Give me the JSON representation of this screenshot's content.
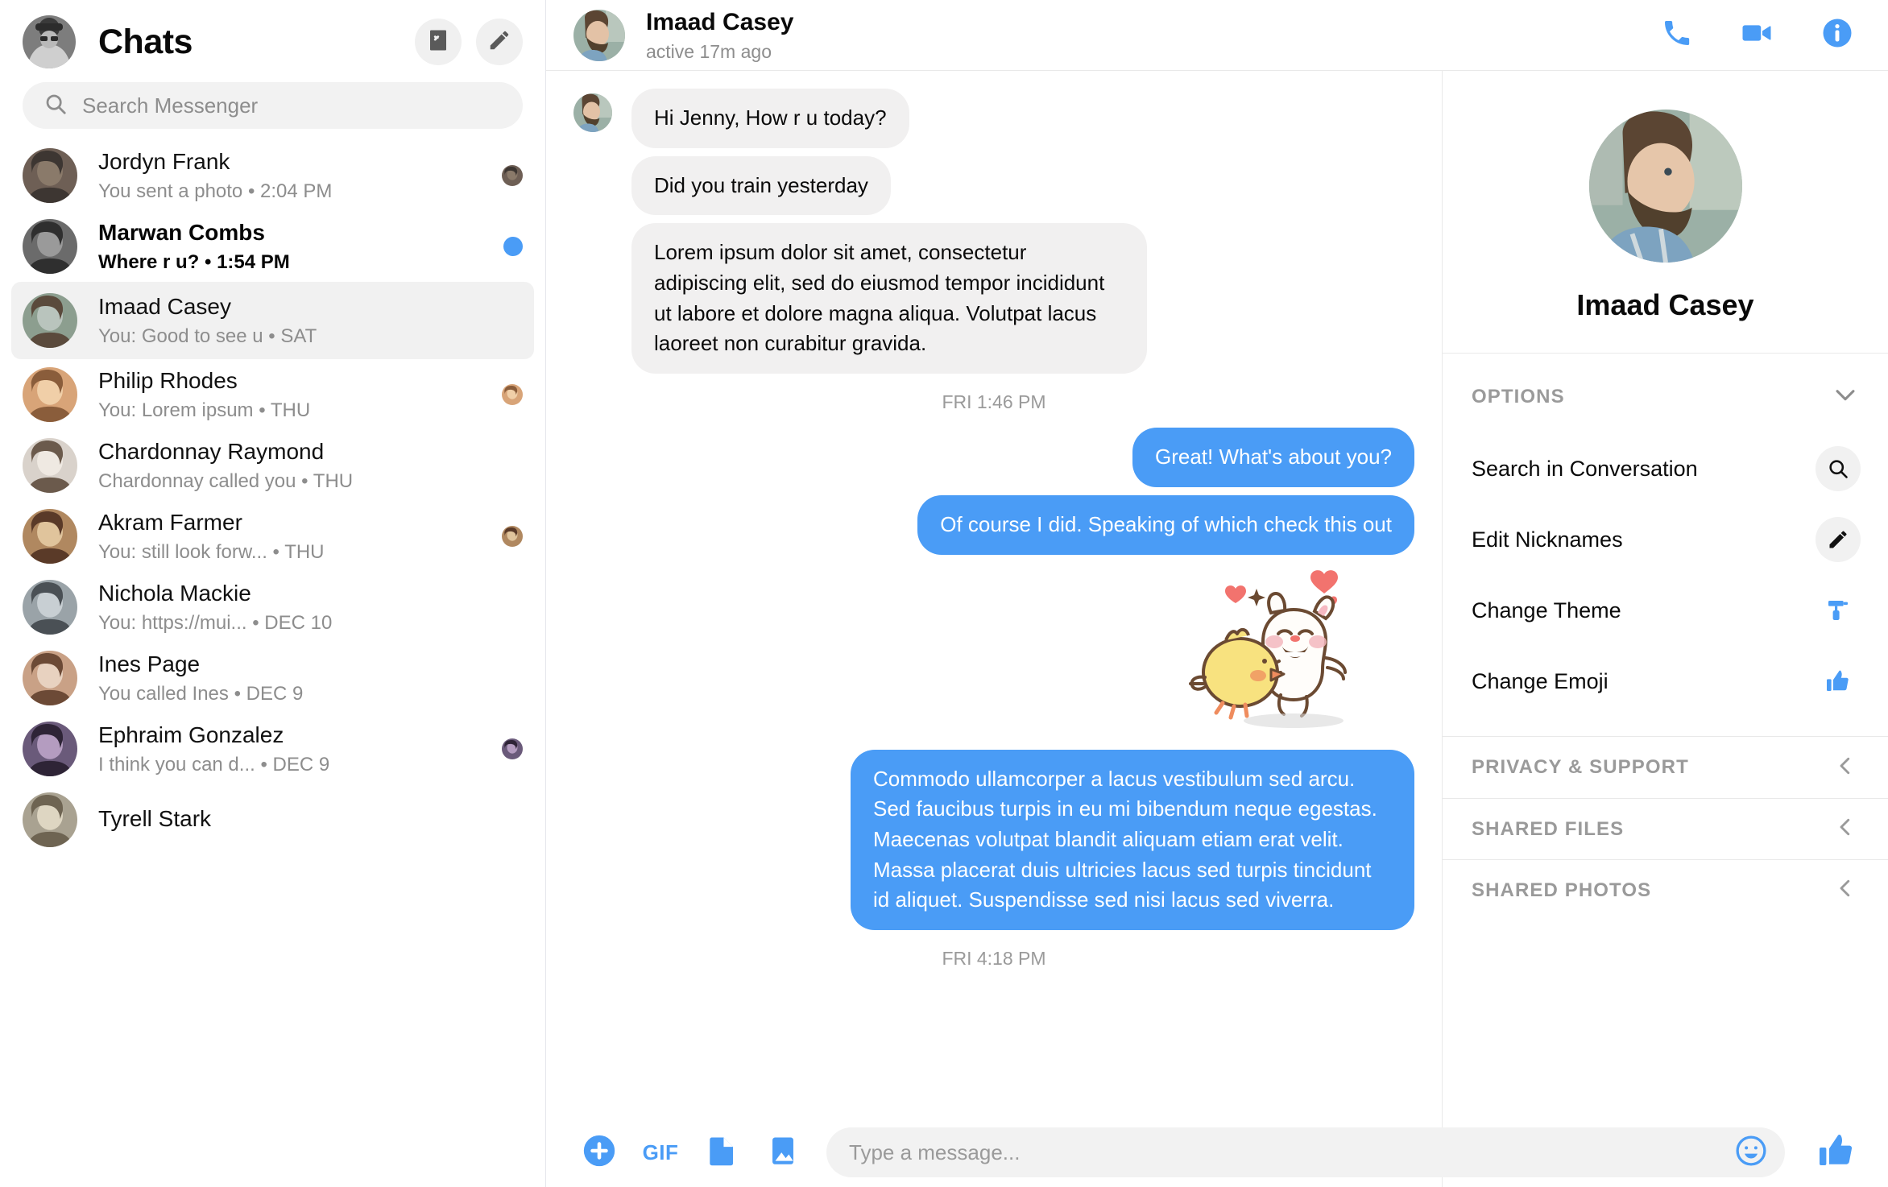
{
  "sidebar": {
    "title": "Chats",
    "settings_label": "Settings",
    "compose_label": "New Message",
    "search": {
      "placeholder": "Search Messenger"
    },
    "chats": [
      {
        "name": "Jordyn Frank",
        "snippet": "You sent a photo • 2:04 PM",
        "state": "seen",
        "av": [
          "#6e5f55",
          "#3d3632",
          "#8a7a6a"
        ]
      },
      {
        "name": "Marwan Combs",
        "snippet": "Where r u? • 1:54 PM",
        "state": "unread",
        "av": [
          "#6b6b6b",
          "#2f2f2f",
          "#9a9a9a"
        ]
      },
      {
        "name": "Imaad Casey",
        "snippet": "You: Good to see u • SAT",
        "state": "active",
        "av": [
          "#8c9e8f",
          "#5a4a3c",
          "#b9c4bd"
        ]
      },
      {
        "name": "Philip Rhodes",
        "snippet": "You: Lorem ipsum • THU",
        "state": "seen",
        "av": [
          "#d8a478",
          "#8a5d3b",
          "#f0cfa8"
        ]
      },
      {
        "name": "Chardonnay Raymond",
        "snippet": "Chardonnay called you • THU",
        "state": "none",
        "av": [
          "#d9d2cb",
          "#6b5a4c",
          "#efe9e2"
        ]
      },
      {
        "name": "Akram Farmer",
        "snippet": "You: still look forw... • THU",
        "state": "seen",
        "av": [
          "#b08860",
          "#5a3a28",
          "#e0c49c"
        ]
      },
      {
        "name": "Nichola Mackie",
        "snippet": "You: https://mui... • DEC 10",
        "state": "none",
        "av": [
          "#9aa3a8",
          "#4a5055",
          "#c8cfd3"
        ]
      },
      {
        "name": "Ines Page",
        "snippet": "You called Ines • DEC 9",
        "state": "none",
        "av": [
          "#c9a186",
          "#6c4a36",
          "#e8d2c0"
        ]
      },
      {
        "name": "Ephraim Gonzalez",
        "snippet": "I think you can d... • DEC 9",
        "state": "seen",
        "av": [
          "#6a5a7a",
          "#2e2436",
          "#b49cc0"
        ]
      },
      {
        "name": "Tyrell Stark",
        "snippet": "",
        "state": "none",
        "av": [
          "#a9a291",
          "#6e6452",
          "#ded6c2"
        ]
      }
    ]
  },
  "conversation": {
    "contact_name": "Imaad Casey",
    "status": "active 17m ago",
    "actions": {
      "call_label": "Start a voice call",
      "video_label": "Start a video chat",
      "info_label": "Conversation Information"
    },
    "messages": [
      {
        "side": "in",
        "type": "text",
        "text": "Hi Jenny, How r u today?"
      },
      {
        "side": "in",
        "type": "text",
        "text": "Did you train yesterday"
      },
      {
        "side": "in",
        "type": "text",
        "text": "Lorem ipsum dolor sit amet, consectetur adipiscing elit, sed do eiusmod tempor incididunt ut labore et dolore magna aliqua. Volutpat lacus laoreet non curabitur gravida."
      },
      {
        "side": "sep",
        "type": "time",
        "text": "FRI 1:46 PM"
      },
      {
        "side": "out",
        "type": "text",
        "text": "Great! What's about you?"
      },
      {
        "side": "out",
        "type": "text",
        "text": "Of course I did. Speaking of which check this out"
      },
      {
        "side": "out",
        "type": "sticker",
        "text": "bear-hugging-chick-sticker"
      },
      {
        "side": "out",
        "type": "text",
        "text": "Commodo ullamcorper a lacus vestibulum sed arcu. Sed faucibus turpis in eu mi bibendum neque egestas. Maecenas volutpat blandit aliquam etiam erat velit. Massa placerat duis ultricies lacus sed turpis tincidunt id aliquet. Suspendisse sed nisi lacus sed viverra."
      },
      {
        "side": "sep",
        "type": "time",
        "text": "FRI 4:18 PM"
      }
    ],
    "timestamps": {
      "first": "FRI 1:46 PM",
      "second": "FRI 4:18 PM"
    },
    "composer": {
      "placeholder": "Type a message...",
      "add_label": "Add",
      "gif_label": "GIF",
      "file_label": "Attach a file",
      "image_label": "Attach a photo",
      "emoji_label": "Choose an emoji",
      "like_label": "Send a Like"
    }
  },
  "info_panel": {
    "name": "Imaad Casey",
    "options_title": "OPTIONS",
    "options": [
      {
        "label": "Search in Conversation",
        "icon": "search-icon",
        "style": "circle"
      },
      {
        "label": "Edit Nicknames",
        "icon": "pencil-icon",
        "style": "circle"
      },
      {
        "label": "Change Theme",
        "icon": "paint-roller-icon",
        "style": "plain"
      },
      {
        "label": "Change Emoji",
        "icon": "thumbs-up-icon",
        "style": "plain"
      }
    ],
    "sections": [
      {
        "label": "PRIVACY & SUPPORT"
      },
      {
        "label": "SHARED FILES"
      },
      {
        "label": "SHARED PHOTOS"
      }
    ]
  },
  "colors": {
    "accent": "#4a9cf6",
    "incoming_bubble": "#f1f0f0",
    "selected_row": "#f1f1f1",
    "muted_text": "#8d8d8d"
  }
}
